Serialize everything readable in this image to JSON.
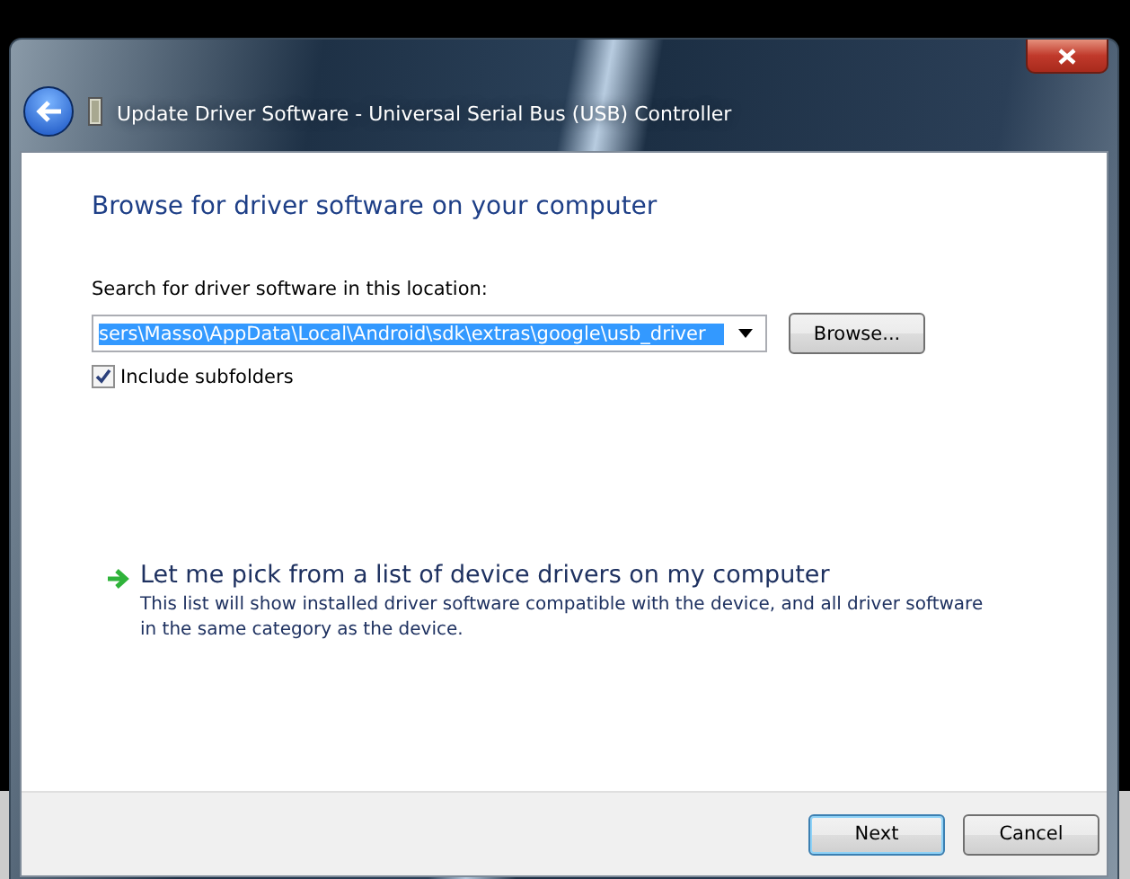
{
  "window": {
    "title": "Update Driver Software - Universal Serial Bus (USB) Controller"
  },
  "heading": "Browse for driver software on your computer",
  "location": {
    "label": "Search for driver software in this location:",
    "value": "sers\\Masso\\AppData\\Local\\Android\\sdk\\extras\\google\\usb_driver",
    "browse": "Browse..."
  },
  "include_subfolders": {
    "label": "Include subfolders",
    "checked": true
  },
  "pick_option": {
    "title": "Let me pick from a list of device drivers on my computer",
    "description": "This list will show installed driver software compatible with the device, and all driver software in the same category as the device."
  },
  "buttons": [
    {
      "label": "Next",
      "default": true
    },
    {
      "label": "Cancel",
      "default": false
    }
  ]
}
